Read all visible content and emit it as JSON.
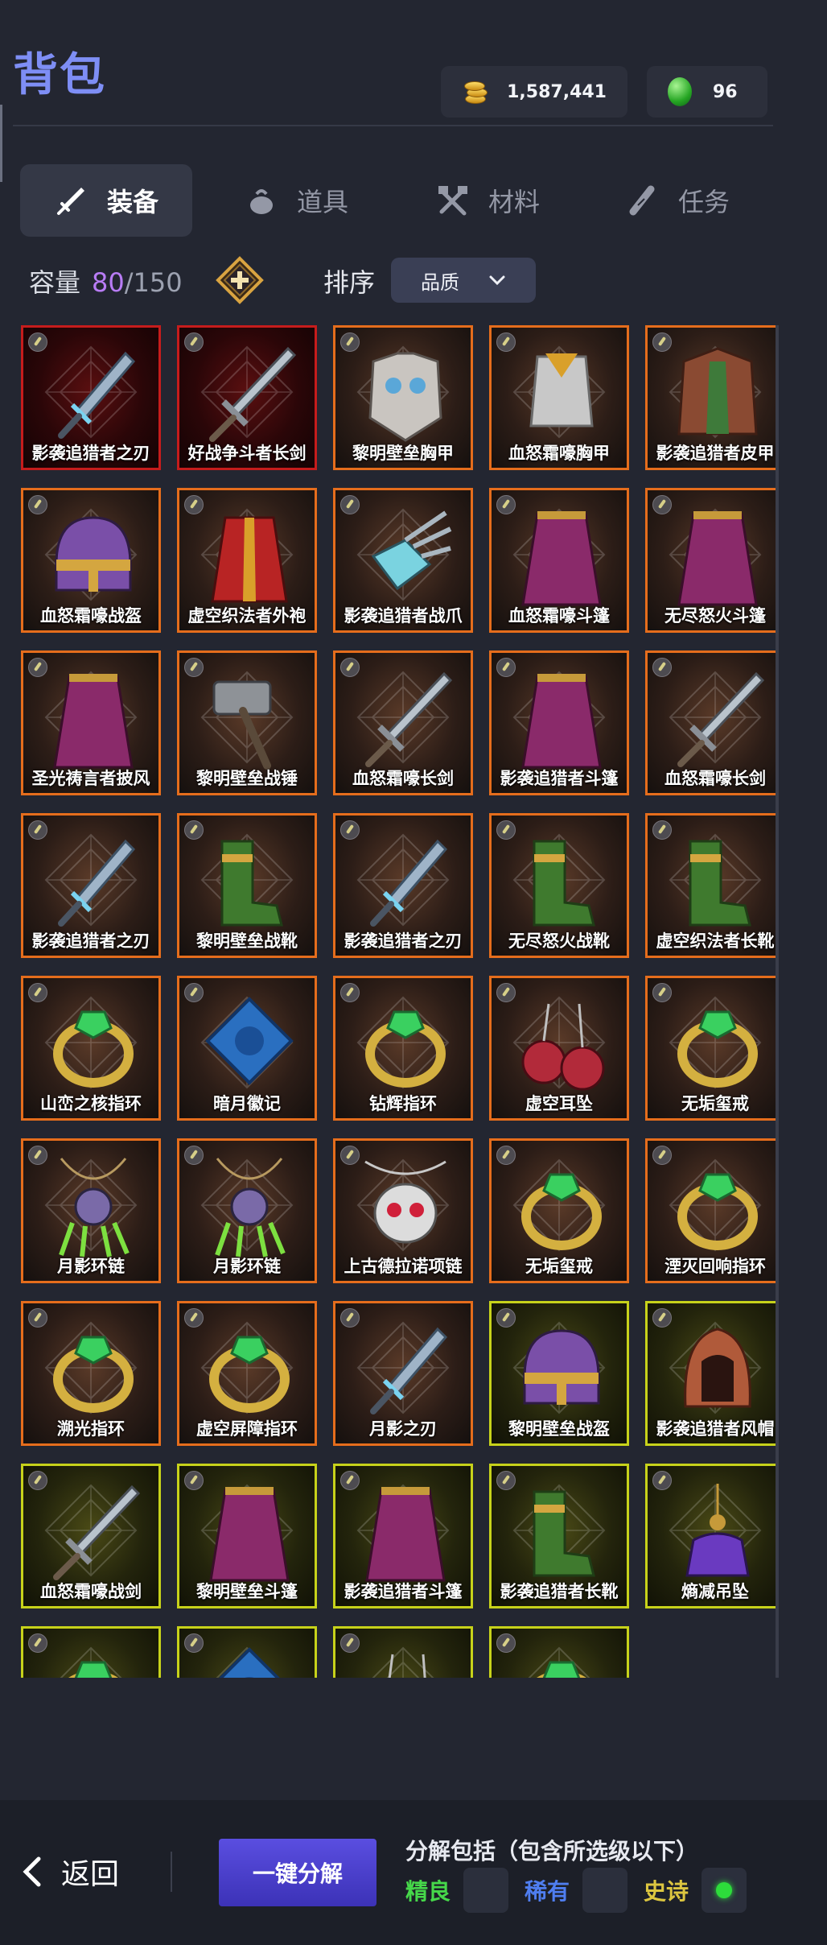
{
  "header": {
    "title": "背包"
  },
  "currency": {
    "gold": "1,587,441",
    "gems": "96"
  },
  "tabs": [
    {
      "label": "装备",
      "icon": "sword-icon",
      "active": true
    },
    {
      "label": "道具",
      "icon": "pouch-icon",
      "active": false
    },
    {
      "label": "材料",
      "icon": "crossed-tools-icon",
      "active": false
    },
    {
      "label": "任务",
      "icon": "scroll-icon",
      "active": false
    }
  ],
  "capacity": {
    "label": "容量",
    "current": "80",
    "separator": "/",
    "max": "150"
  },
  "sort": {
    "label": "排序",
    "value": "品质"
  },
  "colors": {
    "legend": "#e56d1c",
    "artifact": "#c61c1c",
    "epic": "#c7d21a",
    "accent": "#7e8ef5"
  },
  "items": [
    {
      "name": "影袭追猎者之刃",
      "rarity": "artifact",
      "icon": "dagger-icon"
    },
    {
      "name": "好战争斗者长剑",
      "rarity": "artifact",
      "icon": "sword-icon"
    },
    {
      "name": "黎明壁垒胸甲",
      "rarity": "legend",
      "icon": "chestplate-icon"
    },
    {
      "name": "血怒霜嚎胸甲",
      "rarity": "legend",
      "icon": "chainmail-icon"
    },
    {
      "name": "影袭追猎者皮甲",
      "rarity": "legend",
      "icon": "leather-armor-icon"
    },
    {
      "name": "血怒霜嚎战盔",
      "rarity": "legend",
      "icon": "helmet-icon"
    },
    {
      "name": "虚空织法者外袍",
      "rarity": "legend",
      "icon": "robe-icon"
    },
    {
      "name": "影袭追猎者战爪",
      "rarity": "legend",
      "icon": "claw-icon"
    },
    {
      "name": "血怒霜嚎斗篷",
      "rarity": "legend",
      "icon": "cloak-icon"
    },
    {
      "name": "无尽怒火斗篷",
      "rarity": "legend",
      "icon": "cloak-icon"
    },
    {
      "name": "圣光祷言者披风",
      "rarity": "legend",
      "icon": "cloak-icon"
    },
    {
      "name": "黎明壁垒战锤",
      "rarity": "legend",
      "icon": "hammer-icon"
    },
    {
      "name": "血怒霜嚎长剑",
      "rarity": "legend",
      "icon": "sword-icon"
    },
    {
      "name": "影袭追猎者斗篷",
      "rarity": "legend",
      "icon": "cloak-icon"
    },
    {
      "name": "血怒霜嚎长剑",
      "rarity": "legend",
      "icon": "sword-icon"
    },
    {
      "name": "影袭追猎者之刃",
      "rarity": "legend",
      "icon": "dagger-icon"
    },
    {
      "name": "黎明壁垒战靴",
      "rarity": "legend",
      "icon": "boots-icon"
    },
    {
      "name": "影袭追猎者之刃",
      "rarity": "legend",
      "icon": "dagger-icon"
    },
    {
      "name": "无尽怒火战靴",
      "rarity": "legend",
      "icon": "boots-icon"
    },
    {
      "name": "虚空织法者长靴",
      "rarity": "legend",
      "icon": "boots-icon"
    },
    {
      "name": "山峦之核指环",
      "rarity": "legend",
      "icon": "ring-icon"
    },
    {
      "name": "暗月徽记",
      "rarity": "legend",
      "icon": "emblem-icon"
    },
    {
      "name": "钻辉指环",
      "rarity": "legend",
      "icon": "ring-icon"
    },
    {
      "name": "虚空耳坠",
      "rarity": "legend",
      "icon": "earring-icon"
    },
    {
      "name": "无垢玺戒",
      "rarity": "legend",
      "icon": "ring-icon"
    },
    {
      "name": "月影环链",
      "rarity": "legend",
      "icon": "amulet-icon"
    },
    {
      "name": "月影环链",
      "rarity": "legend",
      "icon": "amulet-icon"
    },
    {
      "name": "上古德拉诺项链",
      "rarity": "legend",
      "icon": "skull-necklace-icon"
    },
    {
      "name": "无垢玺戒",
      "rarity": "legend",
      "icon": "ring-icon"
    },
    {
      "name": "湮灭回响指环",
      "rarity": "legend",
      "icon": "ring-icon"
    },
    {
      "name": "溯光指环",
      "rarity": "legend",
      "icon": "ring-icon"
    },
    {
      "name": "虚空屏障指环",
      "rarity": "legend",
      "icon": "ring-icon"
    },
    {
      "name": "月影之刃",
      "rarity": "legend",
      "icon": "dagger-icon"
    },
    {
      "name": "黎明壁垒战盔",
      "rarity": "epic",
      "icon": "helmet-icon"
    },
    {
      "name": "影袭追猎者风帽",
      "rarity": "epic",
      "icon": "hood-icon"
    },
    {
      "name": "血怒霜嚎战剑",
      "rarity": "epic",
      "icon": "sword-icon"
    },
    {
      "name": "黎明壁垒斗篷",
      "rarity": "epic",
      "icon": "cloak-icon"
    },
    {
      "name": "影袭追猎者斗篷",
      "rarity": "epic",
      "icon": "cloak-icon"
    },
    {
      "name": "影袭追猎者长靴",
      "rarity": "epic",
      "icon": "boots-icon"
    },
    {
      "name": "熵减吊坠",
      "rarity": "epic",
      "icon": "pendant-icon"
    },
    {
      "name": "",
      "rarity": "epic",
      "icon": "ring-icon"
    },
    {
      "name": "",
      "rarity": "epic",
      "icon": "emblem-icon"
    },
    {
      "name": "",
      "rarity": "epic",
      "icon": "earring-icon"
    },
    {
      "name": "",
      "rarity": "epic",
      "icon": "ring-icon"
    }
  ],
  "footer": {
    "back_label": "返回",
    "salvage_label": "一键分解",
    "salvage_title": "分解包括（包含所选级以下）",
    "options": [
      {
        "label": "精良",
        "checked": false
      },
      {
        "label": "稀有",
        "checked": false
      },
      {
        "label": "史诗",
        "checked": true
      }
    ]
  }
}
